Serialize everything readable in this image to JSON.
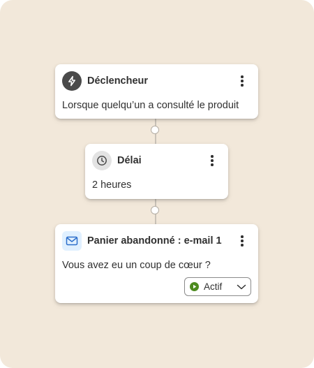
{
  "colors": {
    "background": "#f2e8da",
    "card": "#ffffff",
    "text": "#303030",
    "trigger_icon_bg": "#4a4a4a",
    "email_icon_bg": "#e0f0ff",
    "email_icon": "#2c6ecb",
    "active_status": "#4d8b1f"
  },
  "workflow": {
    "trigger": {
      "icon": "lightning-icon",
      "title": "Déclencheur",
      "description": "Lorsque quelqu’un a consulté le produit"
    },
    "delay": {
      "icon": "clock-icon",
      "title": "Délai",
      "value": "2 heures"
    },
    "email": {
      "icon": "mail-icon",
      "title": "Panier abandonné : e-mail 1",
      "subject": "Vous avez eu un coup de cœur ?",
      "status": {
        "icon": "play-icon",
        "selected": "Actif",
        "dropdown_icon": "chevron-down-icon"
      }
    }
  }
}
